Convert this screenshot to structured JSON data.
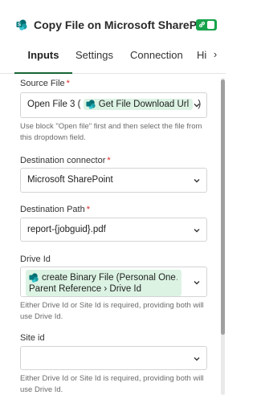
{
  "header": {
    "title": "Copy File on Microsoft SharePoint",
    "icon": "sharepoint-icon",
    "toggle_icon": "link-icon",
    "toggle_color": "#16a34a"
  },
  "tabs": [
    {
      "label": "Inputs",
      "active": true
    },
    {
      "label": "Settings",
      "active": false
    },
    {
      "label": "Connection",
      "active": false
    },
    {
      "label": "Hi",
      "active": false
    }
  ],
  "tabs_scroll_glyph": "›",
  "fields": {
    "source_file": {
      "label": "Source File",
      "required_mark": "*",
      "value_prefix": "Open File 3 (",
      "pill_label": "Get File Download Url",
      "value_suffix": ")",
      "hint": "Use block \"Open file\" first and then select the file from this dropdown field."
    },
    "destination_connector": {
      "label": "Destination connector",
      "required_mark": "*",
      "value": "Microsoft SharePoint"
    },
    "destination_path": {
      "label": "Destination Path",
      "required_mark": "*",
      "value": "report-{jobguid}.pdf"
    },
    "drive_id": {
      "label": "Drive Id",
      "pill_line1": "create Binary File (Personal One…",
      "pill_line2_a": "Parent Reference",
      "pill_line2_sep": "›",
      "pill_line2_b": "Drive Id",
      "hint": "Either Drive Id or Site Id is required, providing both will use Drive Id."
    },
    "site_id": {
      "label": "Site id",
      "value": "",
      "hint": "Either Drive Id or Site Id is required, providing both will use Drive Id."
    }
  },
  "colors": {
    "accent": "#166534",
    "pill_bg": "#dcf3e3",
    "required": "#dc2626"
  }
}
